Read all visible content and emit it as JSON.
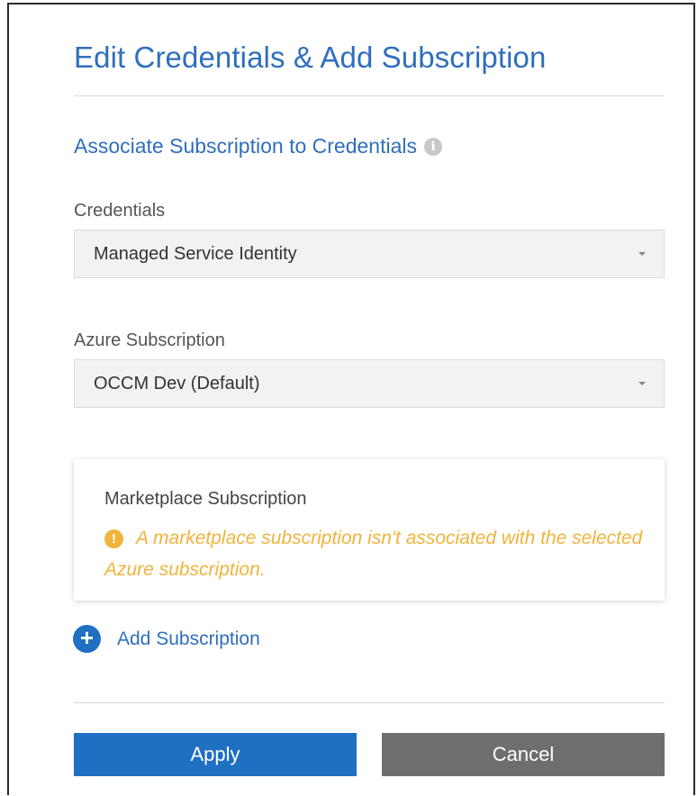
{
  "dialog": {
    "title": "Edit Credentials & Add Subscription",
    "section_heading": "Associate Subscription to Credentials",
    "info_icon_glyph": "i"
  },
  "credentials": {
    "label": "Credentials",
    "value": "Managed Service Identity"
  },
  "azure_subscription": {
    "label": "Azure Subscription",
    "value": "OCCM Dev (Default)"
  },
  "marketplace": {
    "title": "Marketplace Subscription",
    "warning_icon_glyph": "!",
    "warning_text": "A marketplace subscription isn't associated with the selected Azure subscription."
  },
  "add_subscription": {
    "icon_glyph": "+",
    "label": "Add Subscription"
  },
  "buttons": {
    "apply": "Apply",
    "cancel": "Cancel"
  },
  "colors": {
    "accent_blue": "#1f6fc3",
    "title_blue": "#2f6fbd",
    "warning": "#f0b43c",
    "cancel_gray": "#6e6e6e"
  }
}
